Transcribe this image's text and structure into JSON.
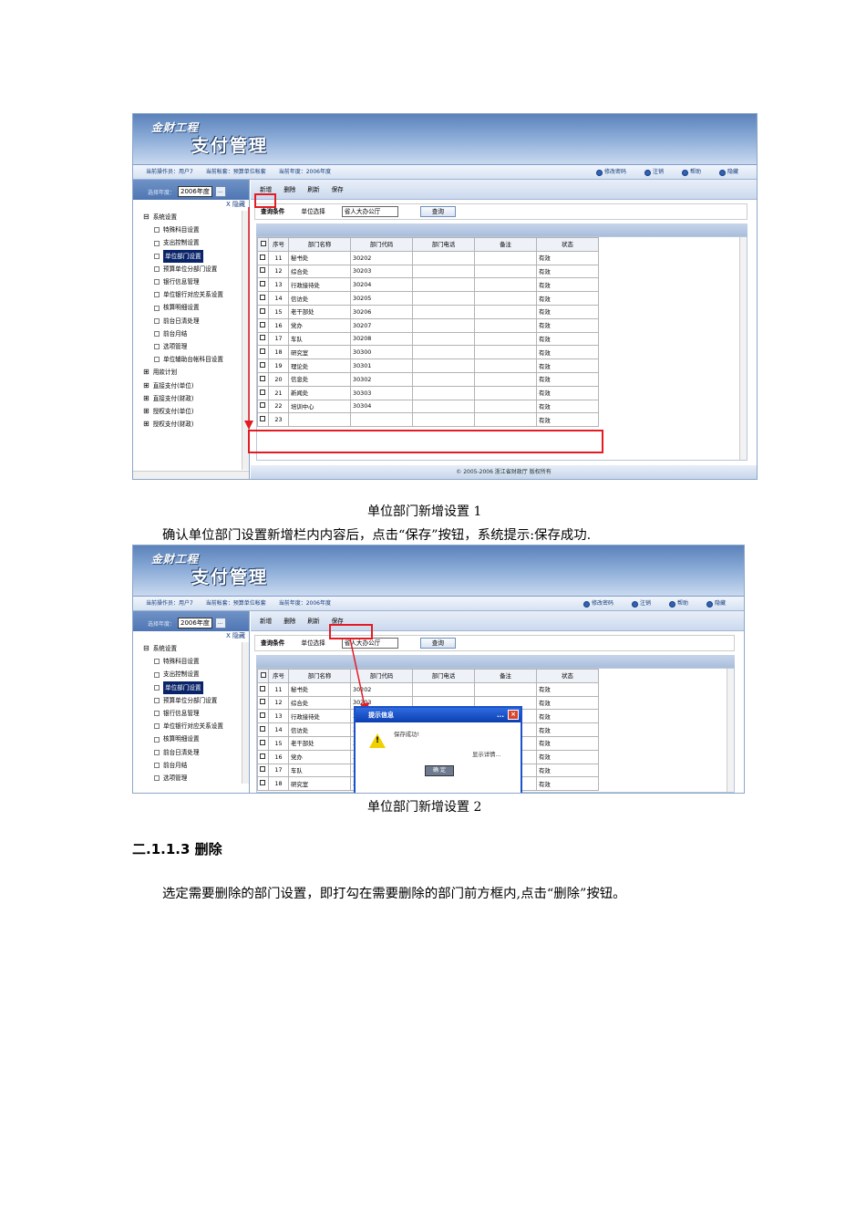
{
  "app": {
    "brand_line1": "金财工程",
    "brand_line2": "支付管理",
    "info_operator": "当前操作员：用户7",
    "info_account": "当前帐套：预算单位帐套",
    "info_year": "当前年度：2006年度",
    "top_links": [
      "修改密码",
      "注销",
      "帮助",
      "隐藏"
    ],
    "year_label": "选择年度：",
    "year_value": "2006年度",
    "year_btn": "...",
    "hide_label": "X 隐藏",
    "tree": [
      {
        "label": "系统设置",
        "level": 0,
        "mark": "⊟"
      },
      {
        "label": "特殊科目设置",
        "level": 1,
        "mark": ""
      },
      {
        "label": "支出控制设置",
        "level": 1,
        "mark": ""
      },
      {
        "label": "单位部门设置",
        "level": 1,
        "mark": "",
        "selected": true
      },
      {
        "label": "预算单位分部门设置",
        "level": 1,
        "mark": ""
      },
      {
        "label": "银行信息管理",
        "level": 1,
        "mark": ""
      },
      {
        "label": "单位银行对应关系设置",
        "level": 1,
        "mark": ""
      },
      {
        "label": "核算明细设置",
        "level": 1,
        "mark": ""
      },
      {
        "label": "前台日清处理",
        "level": 1,
        "mark": ""
      },
      {
        "label": "前台月结",
        "level": 1,
        "mark": ""
      },
      {
        "label": "选项管理",
        "level": 1,
        "mark": ""
      },
      {
        "label": "单位辅助台帐科目设置",
        "level": 1,
        "mark": ""
      },
      {
        "label": "用款计划",
        "level": 0,
        "mark": "⊞"
      },
      {
        "label": "直接支付(单位)",
        "level": 0,
        "mark": "⊞"
      },
      {
        "label": "直接支付(财政)",
        "level": 0,
        "mark": "⊞"
      },
      {
        "label": "授权支付(单位)",
        "level": 0,
        "mark": "⊞"
      },
      {
        "label": "授权支付(财政)",
        "level": 0,
        "mark": "⊞"
      }
    ],
    "toolbar": [
      "新增",
      "删除",
      "刷新",
      "保存"
    ],
    "query_title": "查询条件",
    "query_label": "单位选择",
    "query_value": "省人大办公厅",
    "query_btn": "查询",
    "columns": [
      "序号",
      "部门名称",
      "部门代码",
      "部门电话",
      "备注",
      "状态"
    ],
    "rows": [
      [
        "11",
        "秘书处",
        "30202",
        "",
        "",
        "有效"
      ],
      [
        "12",
        "综合处",
        "30203",
        "",
        "",
        "有效"
      ],
      [
        "13",
        "行政接待处",
        "30204",
        "",
        "",
        "有效"
      ],
      [
        "14",
        "信访处",
        "30205",
        "",
        "",
        "有效"
      ],
      [
        "15",
        "老干部处",
        "30206",
        "",
        "",
        "有效"
      ],
      [
        "16",
        "党办",
        "30207",
        "",
        "",
        "有效"
      ],
      [
        "17",
        "车队",
        "30208",
        "",
        "",
        "有效"
      ],
      [
        "18",
        "研究室",
        "30300",
        "",
        "",
        "有效"
      ],
      [
        "19",
        "理论处",
        "30301",
        "",
        "",
        "有效"
      ],
      [
        "20",
        "信息处",
        "30302",
        "",
        "",
        "有效"
      ],
      [
        "21",
        "新闻处",
        "30303",
        "",
        "",
        "有效"
      ],
      [
        "22",
        "培训中心",
        "30304",
        "",
        "",
        "有效"
      ],
      [
        "23",
        "",
        "",
        "",
        "",
        "有效"
      ]
    ],
    "footer": "© 2005-2006 浙江省财政厅 版权所有"
  },
  "dialog": {
    "title": "提示信息",
    "menu": "...",
    "close": "×",
    "message": "保存成功!",
    "details": "显示详情...",
    "ok": "确 定"
  },
  "doc": {
    "caption1": "单位部门新增设置 1",
    "para1": "确认单位部门设置新增栏内内容后，点击“保存”按钮，系统提示:保存成功.",
    "caption2": "单位部门新增设置 2",
    "heading": "二.1.1.3  删除",
    "para2": "选定需要删除的部门设置，即打勾在需要删除的部门前方框内,点击“删除”按钮。"
  },
  "accent": {
    "red": "#e31c23",
    "banner": "#5b82ba"
  }
}
